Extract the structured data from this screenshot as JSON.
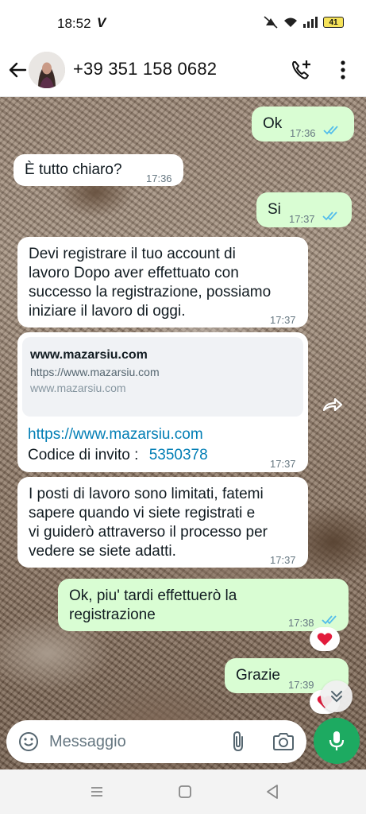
{
  "status_bar": {
    "time": "18:52",
    "carrier_icon": "V",
    "battery": "41"
  },
  "header": {
    "contact": "+39 351 158 0682"
  },
  "messages": {
    "m1": {
      "text": "Ok",
      "time": "17:36"
    },
    "m2": {
      "text": "È tutto chiaro?",
      "time": "17:36"
    },
    "m3": {
      "text": "Si",
      "time": "17:37"
    },
    "m4": {
      "lines": [
        "Devi registrare il tuo account di",
        "lavoro Dopo aver effettuato con",
        "successo la registrazione, possiamo",
        "iniziare il lavoro di oggi."
      ],
      "time": "17:37"
    },
    "m5": {
      "preview_title": "www.mazarsiu.com",
      "preview_url": "https://www.mazarsiu.com",
      "preview_domain": "www.mazarsiu.com",
      "link": "https://www.mazarsiu.com",
      "code_label": "Codice di invito :",
      "code": "5350378",
      "time": "17:37"
    },
    "m6": {
      "lines": [
        "I posti di lavoro sono limitati, fatemi",
        "sapere quando vi siete registrati e",
        "vi guiderò attraverso il processo per",
        "vedere se siete adatti."
      ],
      "time": "17:37"
    },
    "m7": {
      "lines": [
        "Ok, piu' tardi effettuerò la",
        "registrazione"
      ],
      "time": "17:38"
    },
    "m8": {
      "text": "Grazie",
      "time": "17:39"
    }
  },
  "composer": {
    "placeholder": "Messaggio"
  },
  "colors": {
    "outgoing": "#d9fdd3",
    "incoming": "#ffffff",
    "accent": "#1daa61",
    "link": "#027eb5",
    "read_ticks": "#53bdeb"
  },
  "icons": [
    "back-arrow-icon",
    "add-call-icon",
    "more-vert-icon",
    "forward-icon",
    "heart-icon",
    "chevron-double-down-icon",
    "emoji-icon",
    "attach-icon",
    "camera-icon",
    "mic-icon",
    "recents-icon",
    "home-icon",
    "nav-back-icon"
  ]
}
